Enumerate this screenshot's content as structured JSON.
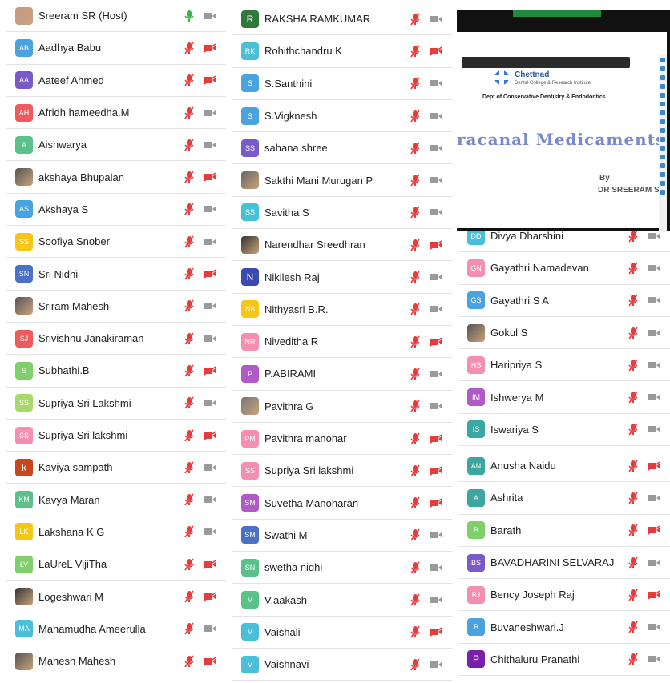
{
  "colors": {
    "mic_muted": "#e83b3b",
    "mic_on": "#3ab24a",
    "cam_muted": "#e83b3b",
    "cam_on": "#9a9a9a"
  },
  "columns": [
    {
      "participants": [
        {
          "name": "Sreeram SR (Host)",
          "initials": "",
          "color": "#c79a86",
          "photo": true,
          "mic": "on",
          "cam": "on"
        },
        {
          "name": "Aadhya Babu",
          "initials": "AB",
          "color": "#4aa3df",
          "mic": "muted",
          "cam": "off"
        },
        {
          "name": "Aateef Ahmed",
          "initials": "AA",
          "color": "#7a5ac8",
          "mic": "muted",
          "cam": "off"
        },
        {
          "name": "Afridh hameedha.M",
          "initials": "AH",
          "color": "#ef5b5b",
          "mic": "muted",
          "cam": "on"
        },
        {
          "name": "Aishwarya",
          "initials": "A",
          "color": "#5cc08a",
          "mic": "muted",
          "cam": "on"
        },
        {
          "name": "akshaya Bhupalan",
          "initials": "",
          "color": "#555",
          "photo": true,
          "mic": "muted",
          "cam": "off"
        },
        {
          "name": "Akshaya S",
          "initials": "AS",
          "color": "#4aa3df",
          "mic": "muted",
          "cam": "on"
        },
        {
          "name": "Soofiya Snober",
          "initials": "SS",
          "color": "#f5c518",
          "mic": "muted",
          "cam": "on"
        },
        {
          "name": "Sri Nidhi",
          "initials": "SN",
          "color": "#4a70c8",
          "mic": "muted",
          "cam": "off"
        },
        {
          "name": "Sriram Mahesh",
          "initials": "",
          "color": "#555",
          "photo": true,
          "mic": "muted",
          "cam": "on"
        },
        {
          "name": "Srivishnu Janakiraman",
          "initials": "SJ",
          "color": "#ef5b5b",
          "mic": "muted",
          "cam": "on"
        },
        {
          "name": "Subhathi.B",
          "initials": "S",
          "color": "#7fcf6a",
          "mic": "muted",
          "cam": "off"
        },
        {
          "name": "Supriya Sri Lakshmi",
          "initials": "SS",
          "color": "#a7d96a",
          "mic": "muted",
          "cam": "on"
        },
        {
          "name": "Supriya Sri lakshmi",
          "initials": "SS",
          "color": "#f58fb0",
          "mic": "muted",
          "cam": "off"
        },
        {
          "name": "Kaviya sampath",
          "initials": "k",
          "color": "#c8461e",
          "big": true,
          "mic": "muted",
          "cam": "on"
        },
        {
          "name": "Kavya Maran",
          "initials": "KM",
          "color": "#5cc08a",
          "mic": "muted",
          "cam": "on"
        },
        {
          "name": "Lakshana K G",
          "initials": "LK",
          "color": "#f5c518",
          "mic": "muted",
          "cam": "on"
        },
        {
          "name": "LaUreL VijiTha",
          "initials": "LV",
          "color": "#7fcf6a",
          "mic": "muted",
          "cam": "off"
        },
        {
          "name": "Logeshwari M",
          "initials": "",
          "color": "#333",
          "photo": true,
          "mic": "muted",
          "cam": "off"
        },
        {
          "name": "Mahamudha Ameerulla",
          "initials": "MA",
          "color": "#4ac0d8",
          "mic": "muted",
          "cam": "on"
        },
        {
          "name": "Mahesh Mahesh",
          "initials": "",
          "color": "#555",
          "photo": true,
          "mic": "muted",
          "cam": "off"
        }
      ]
    },
    {
      "participants": [
        {
          "name": "RAKSHA RAMKUMAR",
          "initials": "R",
          "color": "#2f7a3a",
          "big": true,
          "mic": "muted",
          "cam": "on"
        },
        {
          "name": "Rohithchandru K",
          "initials": "RK",
          "color": "#4ac0d8",
          "mic": "muted",
          "cam": "off"
        },
        {
          "name": "S.Santhini",
          "initials": "S",
          "color": "#4aa3df",
          "mic": "muted",
          "cam": "on"
        },
        {
          "name": "S.Vigknesh",
          "initials": "S",
          "color": "#4aa3df",
          "mic": "muted",
          "cam": "on"
        },
        {
          "name": "sahana shree",
          "initials": "SS",
          "color": "#7a5ac8",
          "mic": "muted",
          "cam": "on"
        },
        {
          "name": "Sakthi Mani Murugan P",
          "initials": "",
          "color": "#666",
          "photo": true,
          "mic": "muted",
          "cam": "on"
        },
        {
          "name": "Savitha S",
          "initials": "SS",
          "color": "#4ac0d8",
          "mic": "muted",
          "cam": "on"
        },
        {
          "name": "Narendhar Sreedhran",
          "initials": "",
          "color": "#333",
          "photo": true,
          "mic": "muted",
          "cam": "off"
        },
        {
          "name": "Nikilesh Raj",
          "initials": "N",
          "color": "#3a4ab0",
          "big": true,
          "mic": "muted",
          "cam": "on"
        },
        {
          "name": "Nithyasri B.R.",
          "initials": "NB",
          "color": "#f5c518",
          "mic": "muted",
          "cam": "on"
        },
        {
          "name": "Niveditha R",
          "initials": "NR",
          "color": "#f58fb0",
          "mic": "muted",
          "cam": "off"
        },
        {
          "name": "P.ABIRAMI",
          "initials": "P",
          "color": "#b05ac8",
          "mic": "muted",
          "cam": "on"
        },
        {
          "name": "Pavithra G",
          "initials": "",
          "color": "#777",
          "photo": true,
          "mic": "muted",
          "cam": "on"
        },
        {
          "name": "Pavithra manohar",
          "initials": "PM",
          "color": "#f58fb0",
          "mic": "muted",
          "cam": "off"
        },
        {
          "name": "Supriya Sri lakshmi",
          "initials": "SS",
          "color": "#f58fb0",
          "mic": "muted",
          "cam": "off"
        },
        {
          "name": "Suvetha Manoharan",
          "initials": "SM",
          "color": "#b05ac8",
          "mic": "muted",
          "cam": "off"
        },
        {
          "name": "Swathi M",
          "initials": "SM",
          "color": "#4a70c8",
          "mic": "muted",
          "cam": "on"
        },
        {
          "name": "swetha nidhi",
          "initials": "SN",
          "color": "#5cc08a",
          "mic": "muted",
          "cam": "on"
        },
        {
          "name": "V.aakash",
          "initials": "V",
          "color": "#5cc08a",
          "mic": "muted",
          "cam": "on"
        },
        {
          "name": "Vaishali",
          "initials": "V",
          "color": "#4ac0d8",
          "mic": "muted",
          "cam": "off"
        },
        {
          "name": "Vaishnavi",
          "initials": "V",
          "color": "#4ac0d8",
          "mic": "muted",
          "cam": "on"
        }
      ]
    },
    {
      "participants_top": [
        {
          "name": "Divya Dharshini",
          "initials": "DD",
          "color": "#4ac0d8",
          "mic": "muted",
          "cam": "on"
        },
        {
          "name": "Gayathri Namadevan",
          "initials": "GN",
          "color": "#f58fb0",
          "mic": "muted",
          "cam": "on"
        },
        {
          "name": "Gayathri S A",
          "initials": "GS",
          "color": "#4aa3df",
          "mic": "muted",
          "cam": "on"
        },
        {
          "name": "Gokul S",
          "initials": "",
          "color": "#555",
          "photo": true,
          "mic": "muted",
          "cam": "on"
        },
        {
          "name": "Haripriya S",
          "initials": "HS",
          "color": "#f58fb0",
          "mic": "muted",
          "cam": "on"
        },
        {
          "name": "Ishwerya M",
          "initials": "IM",
          "color": "#b05ac8",
          "mic": "muted",
          "cam": "on"
        },
        {
          "name": "Iswariya S",
          "initials": "IS",
          "color": "#3aa8a0",
          "mic": "muted",
          "cam": "on"
        }
      ],
      "participants": [
        {
          "name": "Anusha Naidu",
          "initials": "AN",
          "color": "#3aa8a0",
          "mic": "muted",
          "cam": "off"
        },
        {
          "name": "Ashrita",
          "initials": "A",
          "color": "#3aa8a0",
          "mic": "muted",
          "cam": "on"
        },
        {
          "name": "Barath",
          "initials": "B",
          "color": "#7fcf6a",
          "mic": "muted",
          "cam": "off"
        },
        {
          "name": "BAVADHARINI SELVARAJ",
          "initials": "BS",
          "color": "#7a5ac8",
          "mic": "muted",
          "cam": "on"
        },
        {
          "name": "Bency Joseph Raj",
          "initials": "BJ",
          "color": "#f58fb0",
          "mic": "muted",
          "cam": "off"
        },
        {
          "name": "Buvaneshwari.J",
          "initials": "B",
          "color": "#4aa3df",
          "mic": "muted",
          "cam": "on"
        },
        {
          "name": "Chithaluru Pranathi",
          "initials": "P",
          "color": "#7a1fa8",
          "big": true,
          "mic": "muted",
          "cam": "on"
        }
      ]
    }
  ],
  "slide": {
    "logo_name": "Chettnad",
    "logo_sub": "Dental College & Research Institute",
    "dept": "Dept of Conservative Dentistry & Endodontics",
    "title": "racanal Medicaments",
    "by": "By",
    "author": "DR SREERAM S"
  }
}
